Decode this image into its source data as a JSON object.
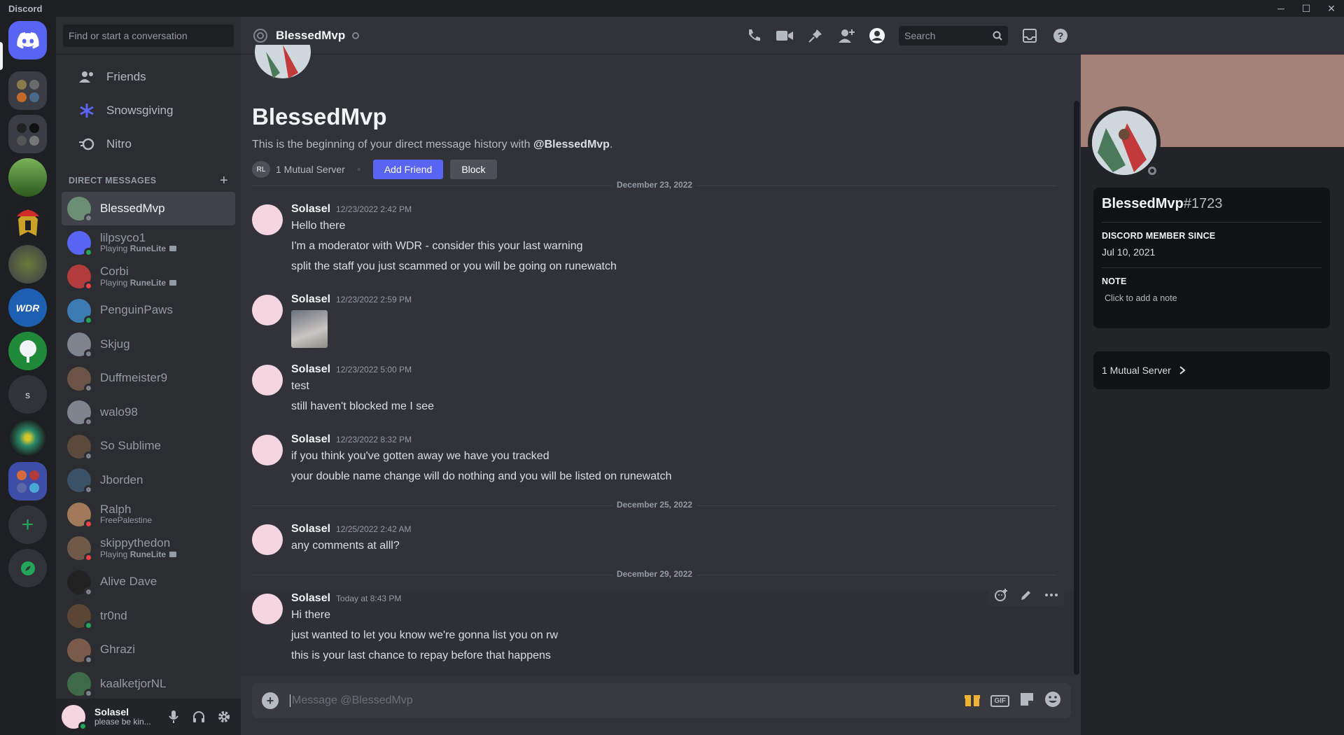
{
  "window": {
    "app_name": "Discord",
    "controls": [
      "─",
      "☐",
      "✕"
    ]
  },
  "dm_sidebar": {
    "search_placeholder": "Find or start a conversation",
    "nav": [
      {
        "label": "Friends",
        "icon": "friends-icon"
      },
      {
        "label": "Snowsgiving",
        "icon": "snowflake-icon"
      },
      {
        "label": "Nitro",
        "icon": "nitro-icon"
      }
    ],
    "dm_header": "DIRECT MESSAGES",
    "dms": [
      {
        "name": "BlessedMvp",
        "sub": "",
        "status": "offline",
        "active": true,
        "avatar_color": "#6a8f73"
      },
      {
        "name": "lilpsyco1",
        "sub_prefix": "Playing ",
        "sub_game": "RuneLite",
        "status": "online",
        "avatar_color": "#5865f2"
      },
      {
        "name": "Corbi",
        "sub_prefix": "Playing ",
        "sub_game": "RuneLite",
        "status": "dnd",
        "avatar_color": "#b23b3b"
      },
      {
        "name": "PenguinPaws",
        "sub": "",
        "status": "online",
        "avatar_color": "#3d7bb5"
      },
      {
        "name": "Skjug",
        "sub": "",
        "status": "offline",
        "avatar_color": "#80848e"
      },
      {
        "name": "Duffmeister9",
        "sub": "",
        "status": "offline",
        "avatar_color": "#6b5445"
      },
      {
        "name": "walo98",
        "sub": "",
        "status": "offline",
        "avatar_color": "#80848e"
      },
      {
        "name": "So Sublime",
        "sub": "",
        "status": "offline",
        "avatar_color": "#5b4a3c"
      },
      {
        "name": "Jborden",
        "sub": "",
        "status": "offline",
        "avatar_color": "#3a5266"
      },
      {
        "name": "Ralph",
        "sub": "FreePalestine",
        "status": "dnd",
        "avatar_color": "#a07a5a"
      },
      {
        "name": "skippythedon",
        "sub_prefix": "Playing ",
        "sub_game": "RuneLite",
        "status": "dnd",
        "avatar_color": "#6f5a4a"
      },
      {
        "name": "Alive Dave",
        "sub": "",
        "status": "offline",
        "avatar_color": "#222"
      },
      {
        "name": "tr0nd",
        "sub": "",
        "status": "mobile",
        "avatar_color": "#5b4636"
      },
      {
        "name": "Ghrazi",
        "sub": "",
        "status": "offline",
        "avatar_color": "#7a5a4a"
      },
      {
        "name": "kaalketjorNL",
        "sub": "",
        "status": "offline",
        "avatar_color": "#3f6a4a"
      }
    ],
    "user": {
      "name": "Solasel",
      "status": "please be kin..."
    }
  },
  "chat": {
    "header_title": "BlessedMvp",
    "search_placeholder": "Search",
    "intro_title": "BlessedMvp",
    "intro_prefix": "This is the beginning of your direct message history with ",
    "intro_handle": "@BlessedMvp",
    "intro_suffix": ".",
    "mutual_server": "1 Mutual Server",
    "mutual_server_initials": "RL",
    "add_friend": "Add Friend",
    "block": "Block",
    "dividers": [
      "December 23, 2022",
      "December 25, 2022",
      "December 29, 2022"
    ],
    "messages": [
      {
        "author": "Solasel",
        "time": "12/23/2022 2:42 PM",
        "lines": [
          "Hello there",
          "I'm a moderator with WDR - consider this your last warning",
          "split the staff you just scammed or you will be going on runewatch"
        ]
      },
      {
        "author": "Solasel",
        "time": "12/23/2022 2:59 PM",
        "lines": []
      },
      {
        "author": "Solasel",
        "time": "12/23/2022 5:00 PM",
        "lines": [
          "test",
          "still haven't blocked me I see"
        ]
      },
      {
        "author": "Solasel",
        "time": "12/23/2022 8:32 PM",
        "lines": [
          "if you think you've gotten away we have you tracked",
          "your double name change will do nothing and you will be listed on runewatch"
        ]
      },
      {
        "author": "Solasel",
        "time": "12/25/2022 2:42 AM",
        "lines": [
          "any comments at alll?"
        ]
      },
      {
        "author": "Solasel",
        "time": "Today at 8:43 PM",
        "lines": [
          "Hi there",
          "just wanted to let you know we're gonna list you on rw",
          "this is your last chance to repay before that happens"
        ]
      }
    ],
    "composer_placeholder": "Message @BlessedMvp",
    "gif_label": "GIF"
  },
  "profile": {
    "username": "BlessedMvp",
    "discriminator": "#1723",
    "member_since_label": "DISCORD MEMBER SINCE",
    "member_since": "Jul 10, 2021",
    "note_label": "NOTE",
    "note_placeholder": "Click to add a note",
    "mutual_servers": "1 Mutual Server",
    "banner_color": "#a48277"
  },
  "colors": {
    "online": "#23a55a",
    "dnd": "#f23f43",
    "offline": "#80848e",
    "blurple": "#5865f2"
  }
}
